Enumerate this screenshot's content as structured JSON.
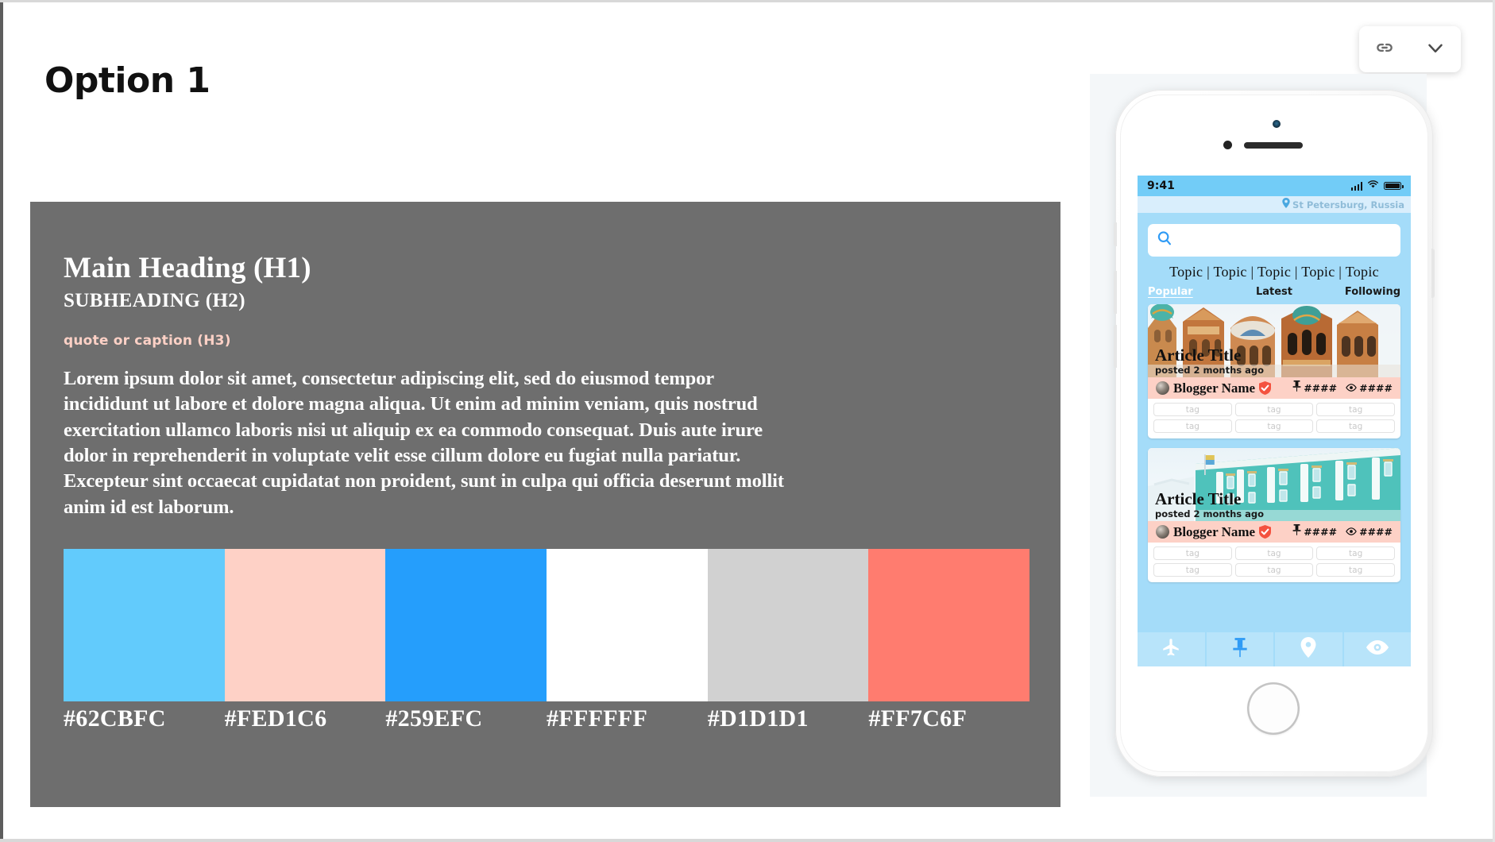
{
  "toolbar": {
    "link_icon": "link-icon",
    "chevron_icon": "chevron-down-icon"
  },
  "slide": {
    "title": "Option 1"
  },
  "panel": {
    "h1": "Main Heading (H1)",
    "h2": "SUBHEADING (H2)",
    "h3": "quote or caption (H3)",
    "body": "Lorem ipsum dolor sit amet, consectetur adipiscing elit, sed do eiusmod tempor incididunt ut labore et dolore magna aliqua. Ut enim ad minim veniam, quis nostrud exercitation ullamco laboris nisi ut aliquip ex ea commodo consequat. Duis aute irure dolor in reprehenderit in voluptate velit esse cillum dolore eu fugiat nulla pariatur. Excepteur sint occaecat cupidatat non proident, sunt in culpa qui officia deserunt mollit anim id est laborum.",
    "background": "#6E6E6E"
  },
  "palette": [
    {
      "hex": "#62CBFC",
      "label": "#62CBFC"
    },
    {
      "hex": "#FED1C6",
      "label": "#FED1C6"
    },
    {
      "hex": "#259EFC",
      "label": "#259EFC"
    },
    {
      "hex": "#FFFFFF",
      "label": "#FFFFFF"
    },
    {
      "hex": "#D1D1D1",
      "label": "#D1D1D1"
    },
    {
      "hex": "#FF7C6F",
      "label": "#FF7C6F"
    }
  ],
  "phone": {
    "status": {
      "time": "9:41",
      "signal_icon": "cellular-signal-icon",
      "wifi_icon": "wifi-icon",
      "battery_icon": "battery-icon"
    },
    "location": {
      "pin_icon": "map-pin-icon",
      "text": "St Petersburg, Russia"
    },
    "search": {
      "icon": "search-icon",
      "value": "",
      "placeholder": ""
    },
    "topics": "Topic | Topic | Topic | Topic | Topic",
    "tabs": [
      {
        "label": "Popular",
        "active": true
      },
      {
        "label": "Latest",
        "active": false
      },
      {
        "label": "Following",
        "active": false
      }
    ],
    "cards": [
      {
        "title": "Article Title",
        "subtitle": "posted 2 months ago",
        "blogger": "Blogger Name",
        "verified_icon": "verified-badge-icon",
        "pin_stat_icon": "pushpin-icon",
        "pin_stat": "####",
        "view_stat_icon": "eye-icon",
        "view_stat": "####",
        "tags": [
          "tag",
          "tag",
          "tag",
          "tag",
          "tag",
          "tag"
        ]
      },
      {
        "title": "Article Title",
        "subtitle": "posted 2 months ago",
        "blogger": "Blogger Name",
        "verified_icon": "verified-badge-icon",
        "pin_stat_icon": "pushpin-icon",
        "pin_stat": "####",
        "view_stat_icon": "eye-icon",
        "view_stat": "####",
        "tags": [
          "tag",
          "tag",
          "tag",
          "tag",
          "tag",
          "tag"
        ]
      }
    ],
    "nav": [
      {
        "icon": "airplane-icon",
        "active": false
      },
      {
        "icon": "pushpin-icon",
        "active": true
      },
      {
        "icon": "map-pin-icon",
        "active": false
      },
      {
        "icon": "eye-icon",
        "active": false
      }
    ]
  }
}
